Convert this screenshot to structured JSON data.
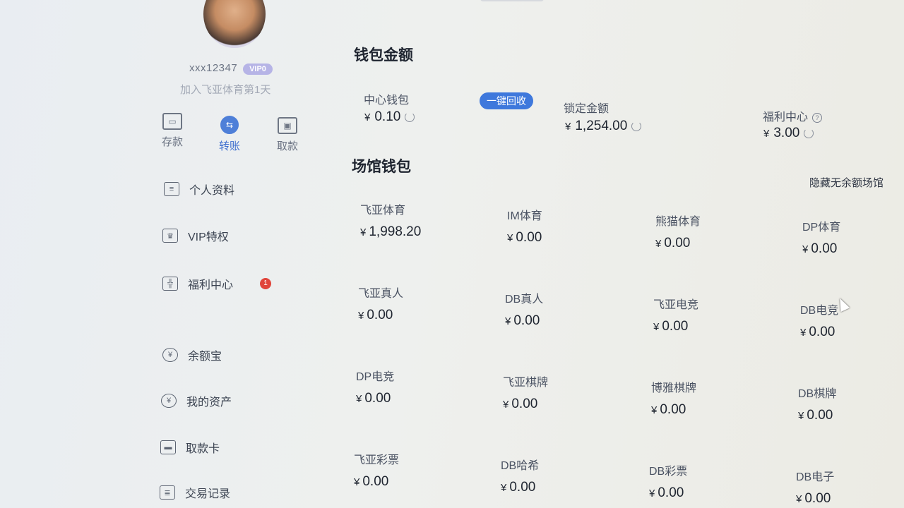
{
  "profile": {
    "username": "xxx12347",
    "vip": "VIP0",
    "join_text": "加入飞亚体育第1天"
  },
  "quick_actions": [
    {
      "label": "存款",
      "icon": "wallet-icon"
    },
    {
      "label": "转账",
      "icon": "transfer-icon"
    },
    {
      "label": "取款",
      "icon": "withdraw-icon"
    }
  ],
  "sidebar": {
    "items": [
      {
        "label": "个人资料",
        "icon": "id-card-icon"
      },
      {
        "label": "VIP特权",
        "icon": "crown-icon"
      },
      {
        "label": "福利中心",
        "icon": "gift-icon",
        "badge": "1"
      },
      {
        "label": "余额宝",
        "icon": "coin-bag-icon"
      },
      {
        "label": "我的资产",
        "icon": "assets-icon"
      },
      {
        "label": "取款卡",
        "icon": "card-icon"
      },
      {
        "label": "交易记录",
        "icon": "records-icon"
      }
    ]
  },
  "wallet": {
    "title": "钱包金额",
    "currency": "¥",
    "center_label": "中心钱包",
    "center_value": "0.10",
    "recycle_button": "一键回收",
    "locked_label": "锁定金额",
    "locked_value": "1,254.00",
    "welfare_label": "福利中心",
    "welfare_value": "3.00"
  },
  "venues": {
    "title": "场馆钱包",
    "hide_link": "隐藏无余额场馆",
    "currency": "¥",
    "items": [
      {
        "name": "飞亚体育",
        "value": "1,998.20"
      },
      {
        "name": "IM体育",
        "value": "0.00"
      },
      {
        "name": "熊猫体育",
        "value": "0.00"
      },
      {
        "name": "DP体育",
        "value": "0.00"
      },
      {
        "name": "飞亚真人",
        "value": "0.00"
      },
      {
        "name": "DB真人",
        "value": "0.00"
      },
      {
        "name": "飞亚电竞",
        "value": "0.00"
      },
      {
        "name": "DB电竞",
        "value": "0.00"
      },
      {
        "name": "DP电竞",
        "value": "0.00"
      },
      {
        "name": "飞亚棋牌",
        "value": "0.00"
      },
      {
        "name": "博雅棋牌",
        "value": "0.00"
      },
      {
        "name": "DB棋牌",
        "value": "0.00"
      },
      {
        "name": "飞亚彩票",
        "value": "0.00"
      },
      {
        "name": "DB哈希",
        "value": "0.00"
      },
      {
        "name": "DB彩票",
        "value": "0.00"
      },
      {
        "name": "DB电子",
        "value": "0.00"
      }
    ]
  },
  "colors": {
    "accent": "#3e78dc",
    "badge": "#e0453b",
    "vip": "#b6b4e6"
  }
}
